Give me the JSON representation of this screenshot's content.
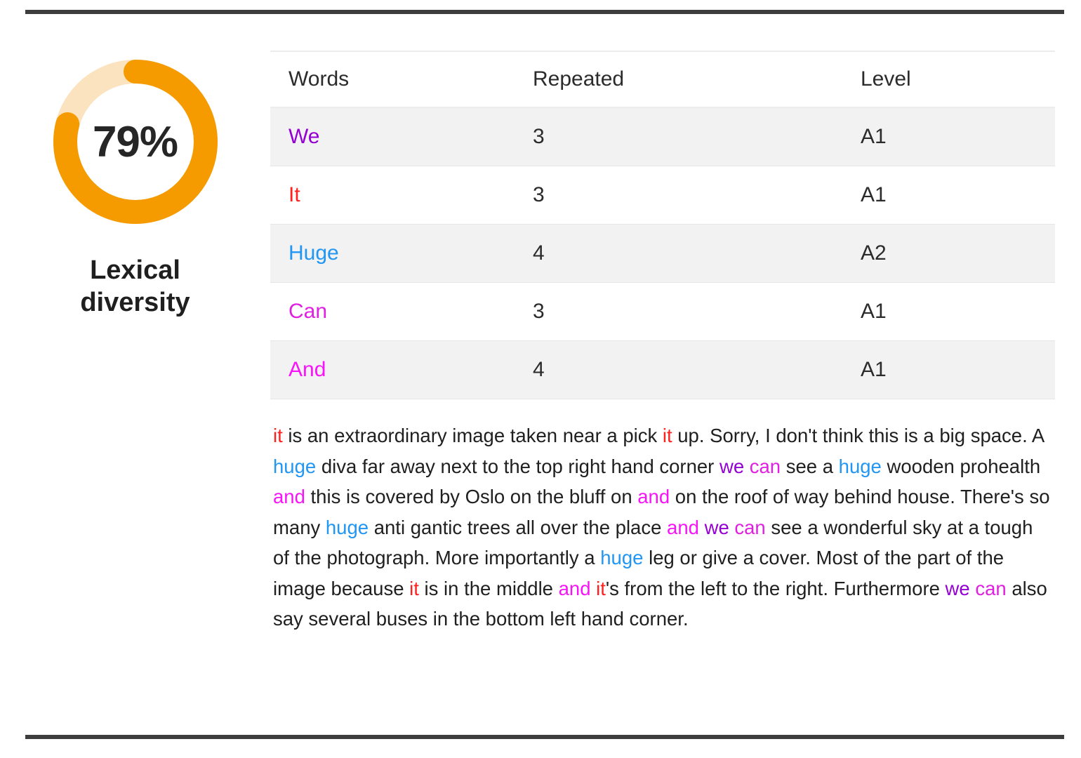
{
  "gauge": {
    "percent": 79,
    "value_text": "79%",
    "label": "Lexical diversity",
    "arc_color": "#F59B00",
    "track_color": "#FCE3C0"
  },
  "colors": {
    "we": "#9400D3",
    "it": "#FF2020",
    "huge": "#2196F3",
    "can": "#E020E0",
    "and": "#F813F8",
    "text": "#1F1F1F",
    "rule": "#3D3D3D",
    "stripe": "#F2F2F2"
  },
  "table": {
    "columns": [
      "Words",
      "Repeated",
      "Level"
    ],
    "rows": [
      {
        "word": "We",
        "repeated": "3",
        "level": "A1",
        "color_key": "we",
        "striped": true
      },
      {
        "word": "It",
        "repeated": "3",
        "level": "A1",
        "color_key": "it",
        "striped": false
      },
      {
        "word": "Huge",
        "repeated": "4",
        "level": "A2",
        "color_key": "huge",
        "striped": true
      },
      {
        "word": "Can",
        "repeated": "3",
        "level": "A1",
        "color_key": "can",
        "striped": false
      },
      {
        "word": "And",
        "repeated": "4",
        "level": "A1",
        "color_key": "and",
        "striped": true
      }
    ]
  },
  "summary": {
    "full_text": "it is an extraordinary image taken near a pick it up. Sorry, I don't think this is a big space. A huge diva far away next to the top right hand corner we can see a huge wooden prohealth and this is covered by Oslo on the bluff on and on the roof of way behind house. There's so many huge anti gantic trees all over the place and we can see a wonderful sky at a tough of the photograph. More importantly a huge leg or give a cover. Most of the part of the image because it is in the middle and it's from the left to the right. Furthermore we can also say several buses in the bottom left hand corner.",
    "segments": [
      {
        "t": "it",
        "c": "it"
      },
      {
        "t": " is an extraordinary image taken near a pick ",
        "c": null
      },
      {
        "t": "it",
        "c": "it"
      },
      {
        "t": " up. Sorry, I don't think this is a big space. A ",
        "c": null
      },
      {
        "t": "huge",
        "c": "huge"
      },
      {
        "t": " diva far away next to the top right hand corner ",
        "c": null
      },
      {
        "t": "we",
        "c": "we"
      },
      {
        "t": " ",
        "c": null
      },
      {
        "t": "can",
        "c": "can"
      },
      {
        "t": " see a ",
        "c": null
      },
      {
        "t": "huge",
        "c": "huge"
      },
      {
        "t": " wooden prohealth ",
        "c": null
      },
      {
        "t": "and",
        "c": "and"
      },
      {
        "t": " this is covered by Oslo on the bluff on ",
        "c": null
      },
      {
        "t": "and",
        "c": "and"
      },
      {
        "t": " on the roof of way behind house. There's so many ",
        "c": null
      },
      {
        "t": "huge",
        "c": "huge"
      },
      {
        "t": " anti gantic trees all over the place ",
        "c": null
      },
      {
        "t": "and",
        "c": "and"
      },
      {
        "t": " ",
        "c": null
      },
      {
        "t": "we",
        "c": "we"
      },
      {
        "t": " ",
        "c": null
      },
      {
        "t": "can",
        "c": "can"
      },
      {
        "t": " see a wonderful sky at a tough of the photograph. More importantly a ",
        "c": null
      },
      {
        "t": "huge",
        "c": "huge"
      },
      {
        "t": " leg or give a cover. Most of the part of the image because ",
        "c": null
      },
      {
        "t": "it",
        "c": "it"
      },
      {
        "t": " is in the middle ",
        "c": null
      },
      {
        "t": "and",
        "c": "and"
      },
      {
        "t": " ",
        "c": null
      },
      {
        "t": "it",
        "c": "it"
      },
      {
        "t": "'s from the left to the right. Furthermore ",
        "c": null
      },
      {
        "t": "we",
        "c": "we"
      },
      {
        "t": " ",
        "c": null
      },
      {
        "t": "can",
        "c": "can"
      },
      {
        "t": " also say several buses in the bottom left hand corner.",
        "c": null
      }
    ]
  }
}
